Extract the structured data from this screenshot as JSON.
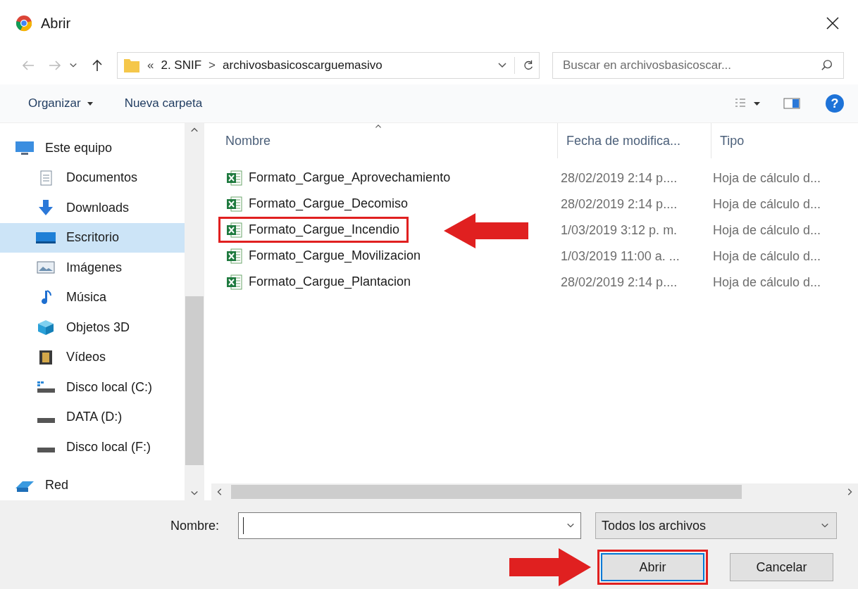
{
  "window": {
    "title": "Abrir"
  },
  "address": {
    "prefix": "«",
    "segments": [
      "2. SNIF",
      "archivosbasicoscarguemasivo"
    ],
    "separator": ">"
  },
  "search": {
    "placeholder": "Buscar en archivosbasicoscar..."
  },
  "toolbar": {
    "organize": "Organizar",
    "new_folder": "Nueva carpeta",
    "help": "?"
  },
  "sidebar": {
    "items": [
      {
        "label": "Este equipo",
        "kind": "computer",
        "selected": false,
        "children": [
          {
            "label": "Documentos",
            "kind": "documents",
            "selected": false
          },
          {
            "label": "Downloads",
            "kind": "downloads",
            "selected": false
          },
          {
            "label": "Escritorio",
            "kind": "desktop",
            "selected": true
          },
          {
            "label": "Imágenes",
            "kind": "pictures",
            "selected": false
          },
          {
            "label": "Música",
            "kind": "music",
            "selected": false
          },
          {
            "label": "Objetos 3D",
            "kind": "objects",
            "selected": false
          },
          {
            "label": "Vídeos",
            "kind": "videos",
            "selected": false
          },
          {
            "label": "Disco local (C:)",
            "kind": "system-drive",
            "selected": false
          },
          {
            "label": "DATA (D:)",
            "kind": "drive",
            "selected": false
          },
          {
            "label": "Disco local (F:)",
            "kind": "drive",
            "selected": false
          }
        ]
      },
      {
        "label": "Red",
        "kind": "network",
        "selected": false
      }
    ]
  },
  "table": {
    "columns": [
      "Nombre",
      "Fecha de modifica...",
      "Tipo"
    ],
    "rows": [
      {
        "name": "Formato_Cargue_Aprovechamiento",
        "date": "28/02/2019 2:14 p....",
        "type": "Hoja de cálculo d...",
        "highlighted": false
      },
      {
        "name": "Formato_Cargue_Decomiso",
        "date": "28/02/2019 2:14 p....",
        "type": "Hoja de cálculo d...",
        "highlighted": false
      },
      {
        "name": "Formato_Cargue_Incendio",
        "date": "1/03/2019 3:12 p. m.",
        "type": "Hoja de cálculo d...",
        "highlighted": true
      },
      {
        "name": "Formato_Cargue_Movilizacion",
        "date": "1/03/2019 11:00 a. ...",
        "type": "Hoja de cálculo d...",
        "highlighted": false
      },
      {
        "name": "Formato_Cargue_Plantacion",
        "date": "28/02/2019 2:14 p....",
        "type": "Hoja de cálculo d...",
        "highlighted": false
      }
    ]
  },
  "footer": {
    "name_label": "Nombre:",
    "filter": "Todos los archivos",
    "buttons": [
      {
        "label": "Abrir",
        "default": true,
        "highlighted": true
      },
      {
        "label": "Cancelar",
        "default": false,
        "highlighted": false
      }
    ]
  }
}
